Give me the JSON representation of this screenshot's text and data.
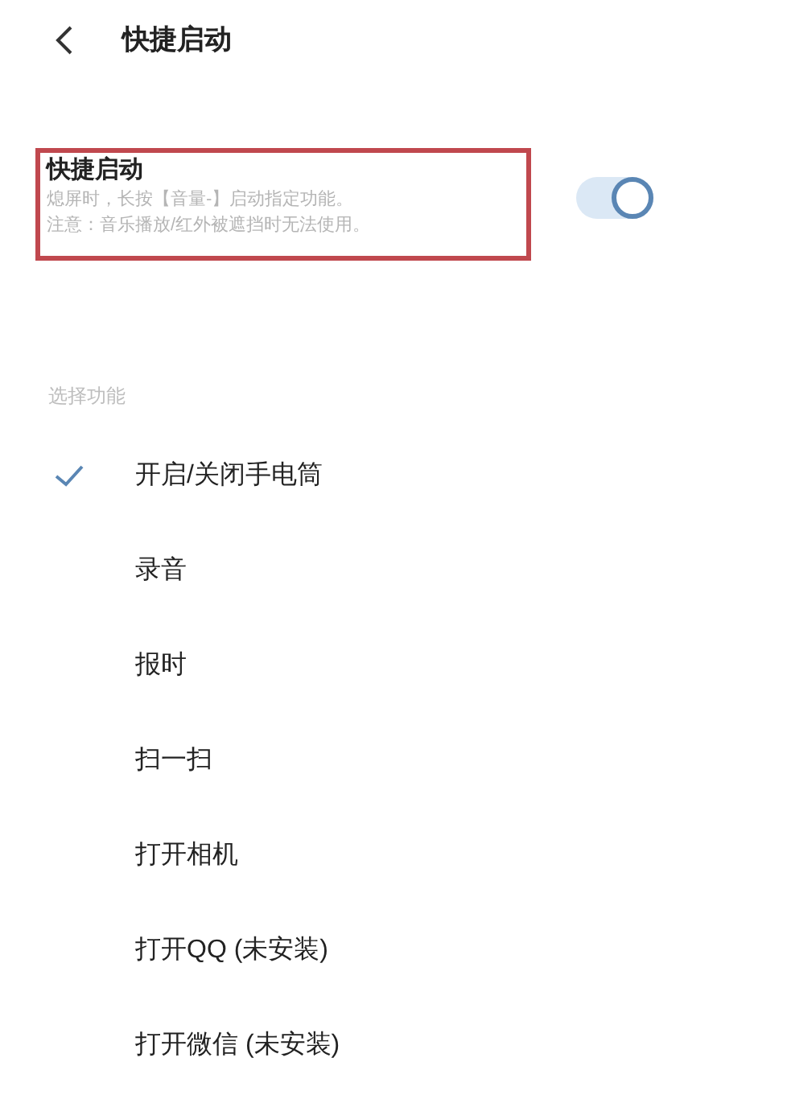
{
  "header": {
    "title": "快捷启动"
  },
  "setting": {
    "title": "快捷启动",
    "highlighted": true,
    "on": true,
    "lines": [
      "熄屏时，长按【音量-】启动指定功能。",
      "注意：音乐播放/红外被遮挡时无法使用。"
    ]
  },
  "section_label": "选择功能",
  "options": [
    {
      "label": "开启/关闭手电筒",
      "selected": true
    },
    {
      "label": "录音",
      "selected": false
    },
    {
      "label": "报时",
      "selected": false
    },
    {
      "label": "扫一扫",
      "selected": false
    },
    {
      "label": "打开相机",
      "selected": false
    },
    {
      "label": "打开QQ (未安装)",
      "selected": false
    },
    {
      "label": "打开微信 (未安装)",
      "selected": false
    }
  ]
}
